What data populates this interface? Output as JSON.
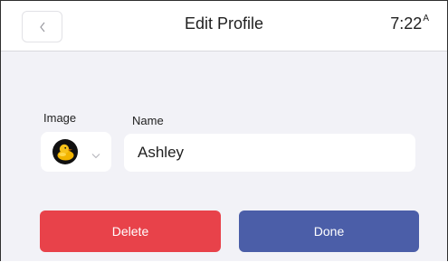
{
  "header": {
    "title": "Edit Profile",
    "back_icon": "chevron-left-icon",
    "time": "7:22",
    "time_suffix": "A"
  },
  "form": {
    "image_label": "Image",
    "name_label": "Name",
    "name_value": "Ashley",
    "avatar_icon": "rubber-duck-icon",
    "dropdown_icon": "chevron-down-icon"
  },
  "actions": {
    "delete_label": "Delete",
    "done_label": "Done"
  },
  "colors": {
    "delete": "#e8424a",
    "done": "#4b5ea8",
    "background": "#f2f2f7"
  }
}
